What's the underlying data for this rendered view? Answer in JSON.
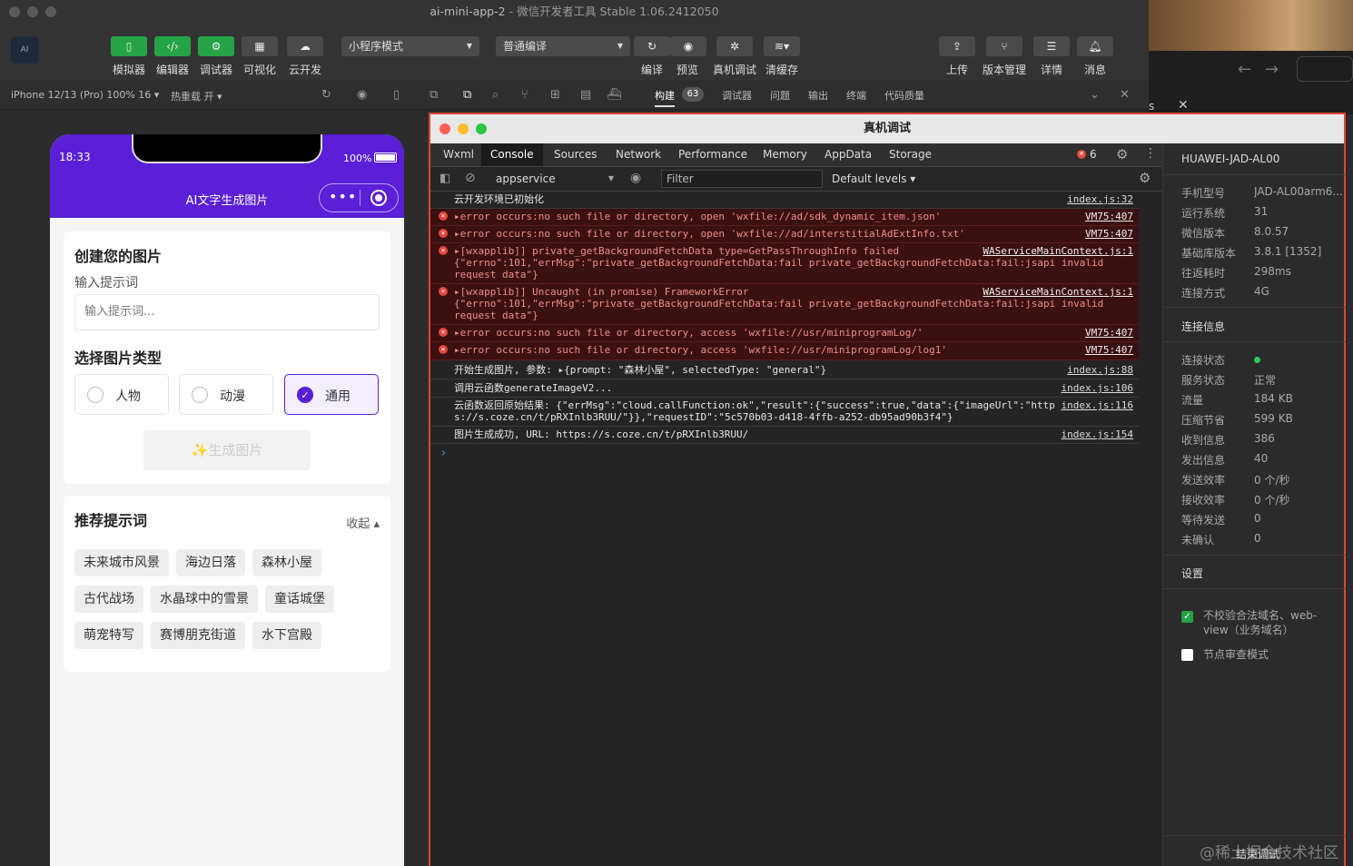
{
  "window": {
    "title": "ai-mini-app-2",
    "subtitle": "微信开发者工具 Stable 1.06.2412050"
  },
  "toolbar": {
    "left_buttons": [
      {
        "label": "模拟器",
        "icon": "phone-icon"
      },
      {
        "label": "编辑器",
        "icon": "code-icon"
      },
      {
        "label": "调试器",
        "icon": "debug-icon"
      },
      {
        "label": "可视化",
        "icon": "layout-icon"
      },
      {
        "label": "云开发",
        "icon": "cloud-icon"
      }
    ],
    "mode_select": "小程序模式",
    "compile_select": "普通编译",
    "mid_buttons": [
      {
        "label": "编译",
        "icon": "refresh-icon"
      },
      {
        "label": "预览",
        "icon": "eye-icon"
      },
      {
        "label": "真机调试",
        "icon": "bug-icon"
      },
      {
        "label": "清缓存",
        "icon": "layers-icon"
      }
    ],
    "right_buttons": [
      {
        "label": "上传",
        "icon": "upload-icon"
      },
      {
        "label": "版本管理",
        "icon": "branch-icon"
      },
      {
        "label": "详情",
        "icon": "menu-icon"
      },
      {
        "label": "消息",
        "icon": "bell-icon"
      }
    ]
  },
  "subbar": {
    "device": "iPhone 12/13 (Pro) 100% 16 ▾",
    "hotreload": "热重载 开 ▾",
    "panel_tabs": [
      "构建",
      "调试器",
      "问题",
      "输出",
      "终端",
      "代码质量"
    ],
    "build_badge": "63",
    "overflow_s": "s"
  },
  "phone": {
    "time": "18:33",
    "battery": "100%",
    "page_title": "AI文字生成图片",
    "create_card": {
      "title": "创建您的图片",
      "prompt_label": "输入提示词",
      "prompt_placeholder": "输入提示词...",
      "type_title": "选择图片类型",
      "types": [
        {
          "label": "人物",
          "selected": false
        },
        {
          "label": "动漫",
          "selected": false
        },
        {
          "label": "通用",
          "selected": true
        }
      ],
      "generate_button": "✨生成图片"
    },
    "suggest_card": {
      "title": "推荐提示词",
      "collapse": "收起 ▴",
      "chips": [
        "未来城市风景",
        "海边日落",
        "森林小屋",
        "古代战场",
        "水晶球中的雪景",
        "童话城堡",
        "萌宠特写",
        "赛博朋克街道",
        "水下宫殿"
      ]
    }
  },
  "devtools": {
    "title": "真机调试",
    "tabs": [
      "Wxml",
      "Console",
      "Sources",
      "Network",
      "Performance",
      "Memory",
      "AppData",
      "Storage"
    ],
    "active_tab": "Console",
    "error_count": "6",
    "context_select": "appservice",
    "filter_placeholder": "Filter",
    "levels": "Default levels ▾",
    "prompt_symbol": "›",
    "log": [
      {
        "type": "info",
        "text": "云开发环境已初始化",
        "src": "index.js:32"
      },
      {
        "type": "error",
        "text": "▸error occurs:no such file or directory, open 'wxfile://ad/sdk_dynamic_item.json'",
        "src": "VM75:407"
      },
      {
        "type": "error",
        "text": "▸error occurs:no such file or directory, open 'wxfile://ad/interstitialAdExtInfo.txt'",
        "src": "VM75:407"
      },
      {
        "type": "error",
        "text": "▸[wxapplib]] private_getBackgroundFetchData type=GetPassThroughInfo failed\n{\"errno\":101,\"errMsg\":\"private_getBackgroundFetchData:fail private_getBackgroundFetchData:fail:jsapi invalid\nrequest data\"}",
        "src": "WAServiceMainContext.js:1"
      },
      {
        "type": "error",
        "text": "▸[wxapplib]] Uncaught (in promise) FrameworkError\n{\"errno\":101,\"errMsg\":\"private_getBackgroundFetchData:fail private_getBackgroundFetchData:fail:jsapi invalid\nrequest data\"}",
        "src": "WAServiceMainContext.js:1"
      },
      {
        "type": "error",
        "text": "▸error occurs:no such file or directory, access 'wxfile://usr/miniprogramLog/'",
        "src": "VM75:407"
      },
      {
        "type": "error",
        "text": "▸error occurs:no such file or directory, access 'wxfile://usr/miniprogramLog/log1'",
        "src": "VM75:407"
      },
      {
        "type": "info",
        "text": "开始生成图片, 参数: ▸{prompt: \"森林小屋\", selectedType: \"general\"}",
        "src": "index.js:88"
      },
      {
        "type": "info",
        "text": "调用云函数generateImageV2...",
        "src": "index.js:106"
      },
      {
        "type": "info",
        "text": "云函数返回原始结果: {\"errMsg\":\"cloud.callFunction:ok\",\"result\":{\"success\":true,\"data\":{\"imageUrl\":\"https://s.coze.cn/t/pRXInlb3RUU/\"}},\"requestID\":\"5c570b03-d418-4ffb-a252-db95ad90b3f4\"}",
        "src": "index.js:116"
      },
      {
        "type": "info",
        "text": "图片生成成功, URL: https://s.coze.cn/t/pRXInlb3RUU/",
        "src": "index.js:154"
      }
    ],
    "side": {
      "device_name": "HUAWEI-JAD-AL00",
      "device_info": [
        {
          "k": "手机型号",
          "v": "JAD-AL00arm6..."
        },
        {
          "k": "运行系统",
          "v": "31"
        },
        {
          "k": "微信版本",
          "v": "8.0.57"
        },
        {
          "k": "基础库版本",
          "v": "3.8.1 [1352]"
        },
        {
          "k": "往返耗时",
          "v": "298ms"
        },
        {
          "k": "连接方式",
          "v": "4G"
        }
      ],
      "conn_title": "连接信息",
      "conn_info": [
        {
          "k": "连接状态",
          "v": ""
        },
        {
          "k": "服务状态",
          "v": "正常"
        },
        {
          "k": "流量",
          "v": "184 KB"
        },
        {
          "k": "压缩节省",
          "v": "599 KB"
        },
        {
          "k": "收到信息",
          "v": "386"
        },
        {
          "k": "发出信息",
          "v": "40"
        },
        {
          "k": "发送效率",
          "v": "0 个/秒"
        },
        {
          "k": "接收效率",
          "v": "0 个/秒"
        },
        {
          "k": "等待发送",
          "v": "0"
        },
        {
          "k": "未确认",
          "v": "0"
        }
      ],
      "settings_title": "设置",
      "settings": [
        {
          "label": "不校验合法域名、web-view（业务域名）",
          "checked": true
        },
        {
          "label": "节点审查模式",
          "checked": false
        }
      ],
      "end_button": "结束调试",
      "watermark": "@稀土掘金技术社区"
    }
  },
  "colors": {
    "accent_purple": "#5a1fd6",
    "green": "#26a346",
    "error_red": "#e2463d"
  }
}
